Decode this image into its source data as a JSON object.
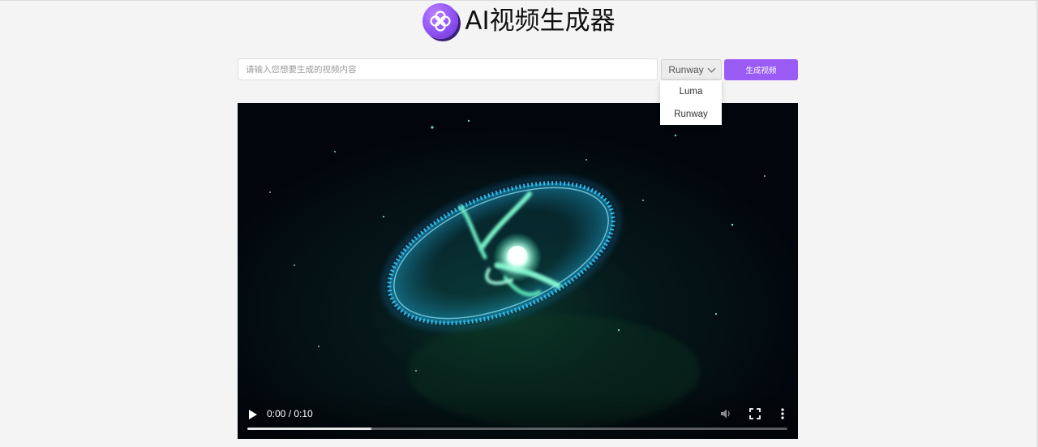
{
  "header": {
    "title": "AI视频生成器",
    "logo_icon": "clover-logo-icon"
  },
  "form": {
    "prompt_placeholder": "请输入您想要生成的视频内容",
    "prompt_value": "",
    "model_selected": "Runway",
    "model_options": [
      "Luma",
      "Runway"
    ],
    "generate_label": "生成视频"
  },
  "video": {
    "time_display": "0:00 / 0:10",
    "progress": 0.23,
    "icons": [
      "play-icon",
      "volume-icon",
      "fullscreen-icon",
      "more-options-icon"
    ]
  },
  "colors": {
    "accent": "#9b5cf6",
    "logo": "#8e52f2",
    "background": "#f4f4f4"
  }
}
